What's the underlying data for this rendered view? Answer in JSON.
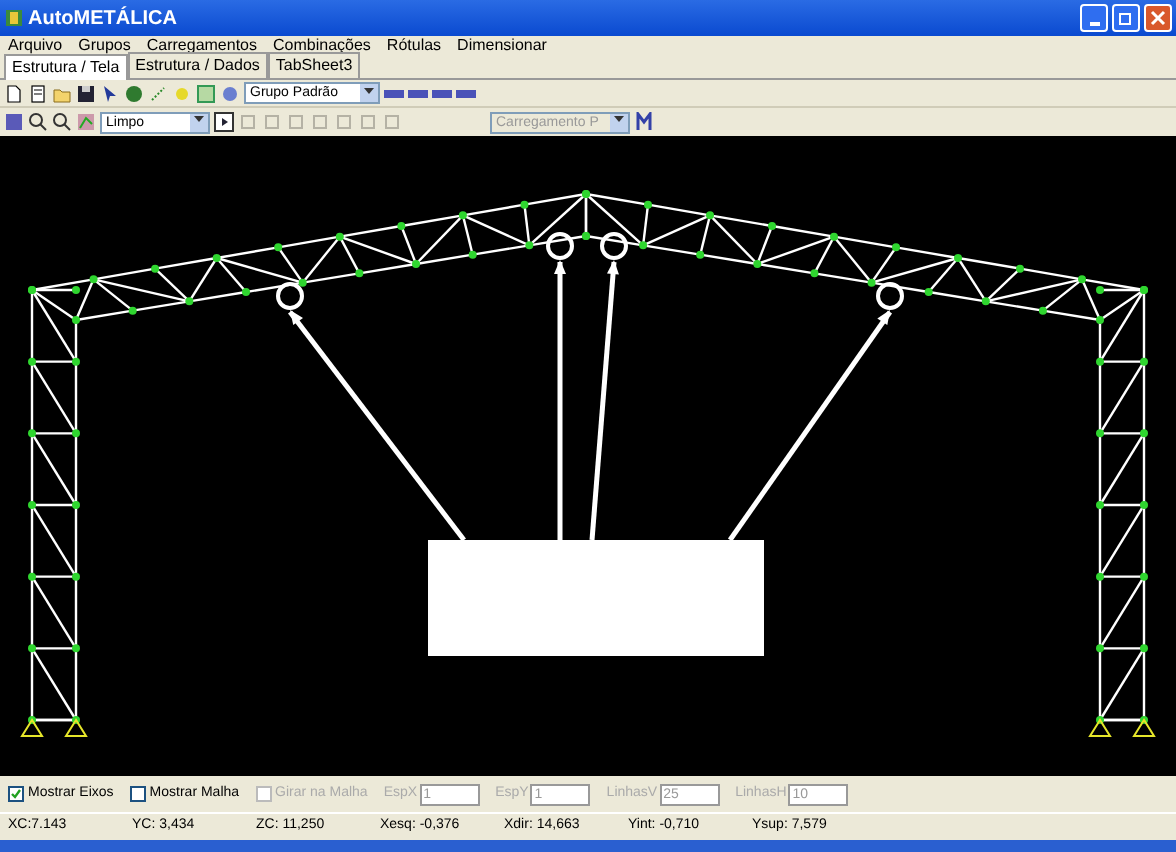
{
  "window": {
    "title": "AutoMETÁLICA"
  },
  "menu": [
    "Arquivo",
    "Grupos",
    "Carregamentos",
    "Combinações",
    "Rótulas",
    "Dimensionar"
  ],
  "tabs": [
    {
      "label": "Estrutura / Tela",
      "selected": true
    },
    {
      "label": "Estrutura / Dados",
      "selected": false
    },
    {
      "label": "TabSheet3",
      "selected": false
    }
  ],
  "toolbar_1": {
    "group_select": "Grupo Padrão"
  },
  "toolbar_2": {
    "view_select": "Limpo",
    "load_select": {
      "value": "Carregamento P",
      "disabled": true
    }
  },
  "options": {
    "checkboxes": [
      {
        "label": "Mostrar Eixos",
        "checked": true,
        "disabled": false
      },
      {
        "label": "Mostrar Malha",
        "checked": false,
        "disabled": false
      },
      {
        "label": "Girar na Malha",
        "checked": false,
        "disabled": true
      }
    ],
    "fields": [
      {
        "label": "EspX",
        "value": "1",
        "disabled": true
      },
      {
        "label": "EspY",
        "value": "1",
        "disabled": true
      },
      {
        "label": "LinhasV",
        "value": "25",
        "disabled": true
      },
      {
        "label": "LinhasH",
        "value": "10",
        "disabled": true
      }
    ]
  },
  "status_bar": [
    "XC:7.143",
    "YC: 3,434",
    "ZC: 11,250",
    "Xesq: -0,376",
    "Xdir: 14,663",
    "Yint: -0,710",
    "Ysup: 7,579"
  ]
}
